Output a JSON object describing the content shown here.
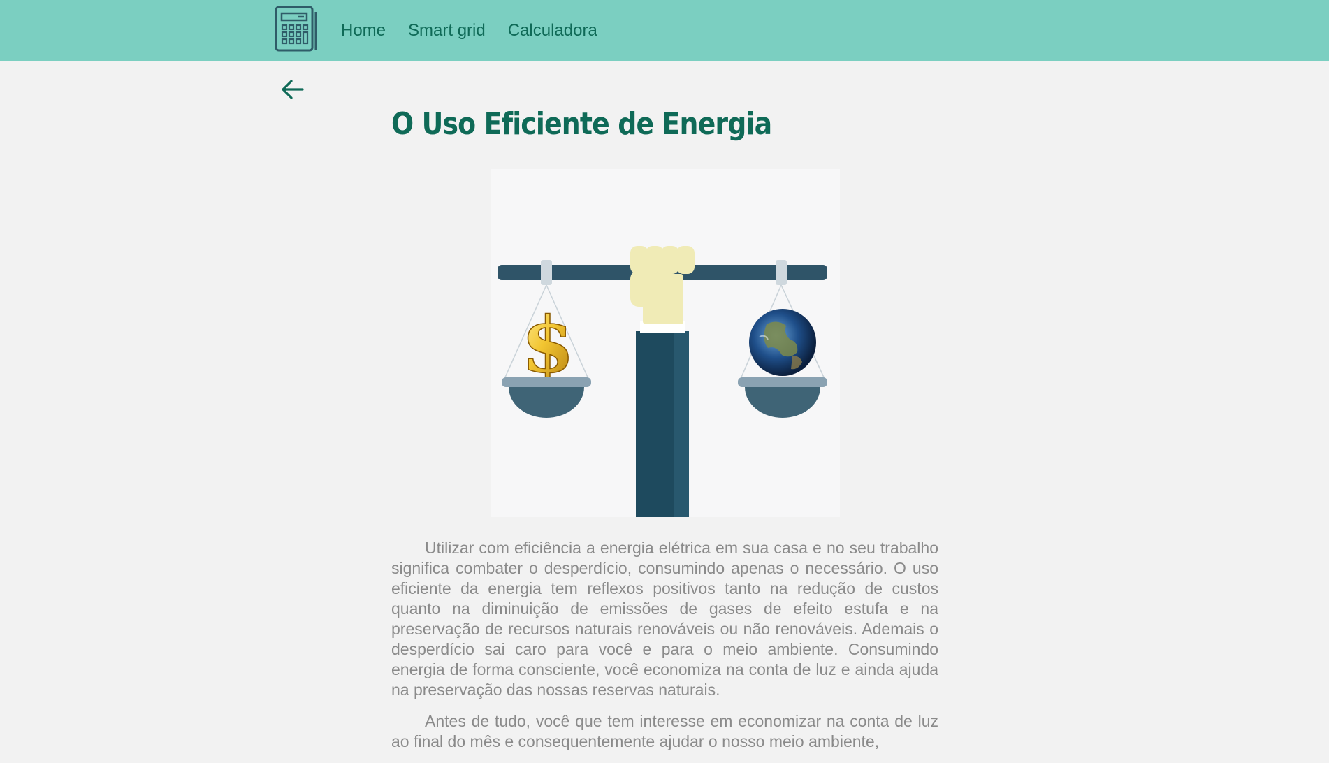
{
  "navbar": {
    "logo_icon": "calculator-icon",
    "links": [
      "Home",
      "Smart grid",
      "Calculadora"
    ]
  },
  "back_icon": "arrow-left-icon",
  "page": {
    "title": "O Uso Eficiente de Energia",
    "illustration": {
      "description_icons": [
        "hand-holding-scale",
        "dollar-sign-icon",
        "globe-earth-icon"
      ]
    },
    "paragraphs": [
      "Utilizar com eficiência a energia elétrica em sua casa e no seu trabalho significa combater o desperdício, consumindo apenas o necessário. O uso eficiente da energia tem reflexos positivos tanto na redução de custos quanto na diminuição de emissões de gases de efeito estufa e na preservação de recursos naturais renováveis ou não renováveis. Ademais o desperdício sai caro para você e para o meio ambiente. Consumindo energia de forma consciente, você economiza na conta de luz e ainda ajuda na preservação das nossas reservas naturais.",
      "Antes de tudo, você que tem interesse em economizar na conta de luz ao final do mês e consequentemente ajudar o nosso meio ambiente,"
    ]
  },
  "colors": {
    "navbar_bg": "#7bcfc1",
    "accent": "#0f6a57",
    "text": "#8a8a8a",
    "page_bg": "#f2f2f2"
  }
}
